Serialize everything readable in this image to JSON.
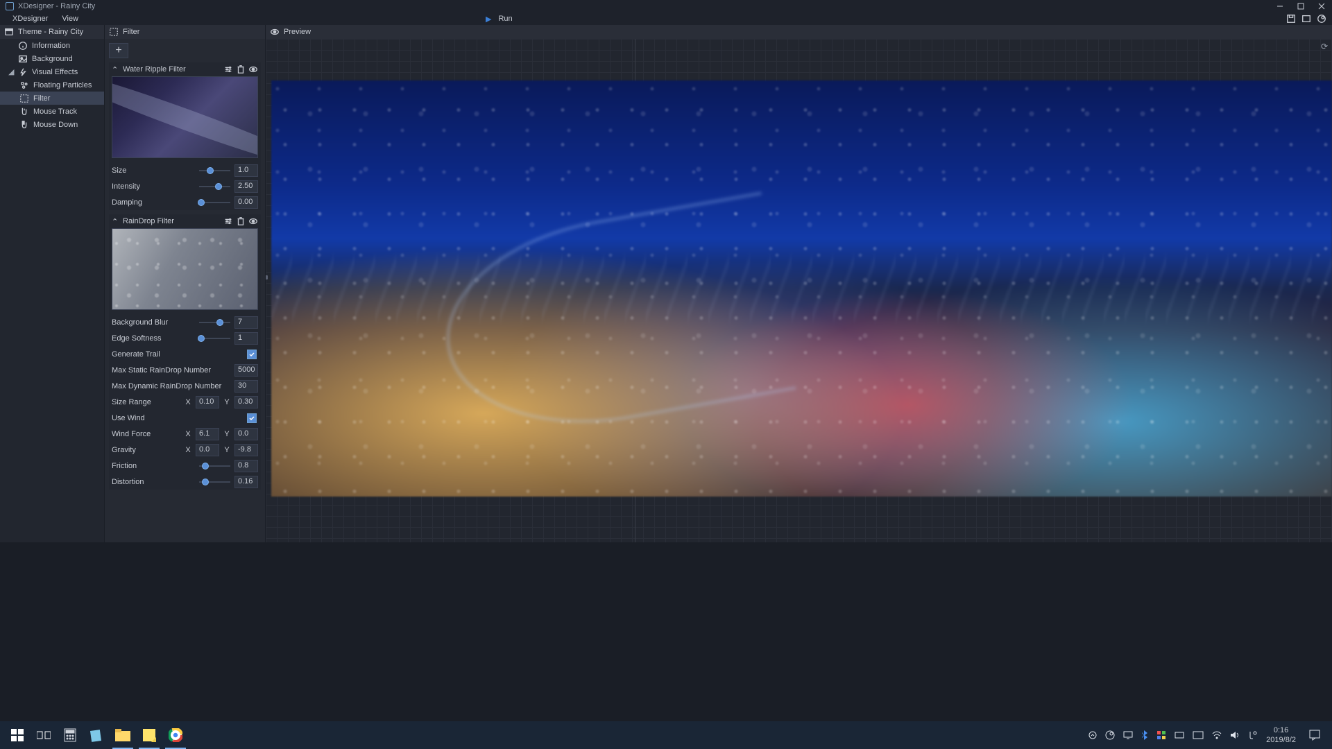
{
  "titlebar": {
    "app": "XDesigner - Rainy City"
  },
  "menubar": {
    "items": [
      "XDesigner",
      "View"
    ],
    "run": "Run"
  },
  "leftpane": {
    "header": "Theme - Rainy City",
    "nodes": [
      {
        "label": "Information",
        "kind": "info"
      },
      {
        "label": "Background",
        "kind": "bg"
      },
      {
        "label": "Visual Effects",
        "kind": "vfx",
        "expandable": true
      },
      {
        "label": "Floating Particles",
        "kind": "part",
        "child": true
      },
      {
        "label": "Filter",
        "kind": "filter",
        "child": true,
        "selected": true
      },
      {
        "label": "Mouse Track",
        "kind": "mtrack",
        "child": true
      },
      {
        "label": "Mouse Down",
        "kind": "mdown",
        "child": true
      }
    ]
  },
  "filterpane": {
    "header": "Filter",
    "addTooltip": "+",
    "filters": [
      {
        "name": "Water Ripple Filter",
        "thumbClass": "wr",
        "props": [
          {
            "type": "slider",
            "label": "Size",
            "value": "1.0",
            "pos": 35
          },
          {
            "type": "slider",
            "label": "Intensity",
            "value": "2.50",
            "pos": 63
          },
          {
            "type": "slider",
            "label": "Damping",
            "value": "0.00",
            "pos": 6
          }
        ]
      },
      {
        "name": "RainDrop Filter",
        "thumbClass": "rd",
        "props": [
          {
            "type": "slider",
            "label": "Background Blur",
            "value": "7",
            "pos": 67
          },
          {
            "type": "slider",
            "label": "Edge Softness",
            "value": "1",
            "pos": 6
          },
          {
            "type": "check",
            "label": "Generate Trail",
            "checked": true
          },
          {
            "type": "num",
            "label": "Max Static RainDrop Number",
            "value": "5000"
          },
          {
            "type": "num",
            "label": "Max Dynamic RainDrop Number",
            "value": "30"
          },
          {
            "type": "xy",
            "label": "Size Range",
            "x": "0.10",
            "y": "0.30"
          },
          {
            "type": "check",
            "label": "Use Wind",
            "checked": true
          },
          {
            "type": "xy",
            "label": "Wind Force",
            "x": "6.1",
            "y": "0.0"
          },
          {
            "type": "xy",
            "label": "Gravity",
            "x": "0.0",
            "y": "-9.8"
          },
          {
            "type": "slider",
            "label": "Friction",
            "value": "0.8",
            "pos": 20
          },
          {
            "type": "slider",
            "label": "Distortion",
            "value": "0.16",
            "pos": 20
          }
        ]
      }
    ]
  },
  "previewpane": {
    "header": "Preview"
  },
  "taskbar": {
    "clock_time": "0:16",
    "clock_date": "2019/8/2"
  }
}
